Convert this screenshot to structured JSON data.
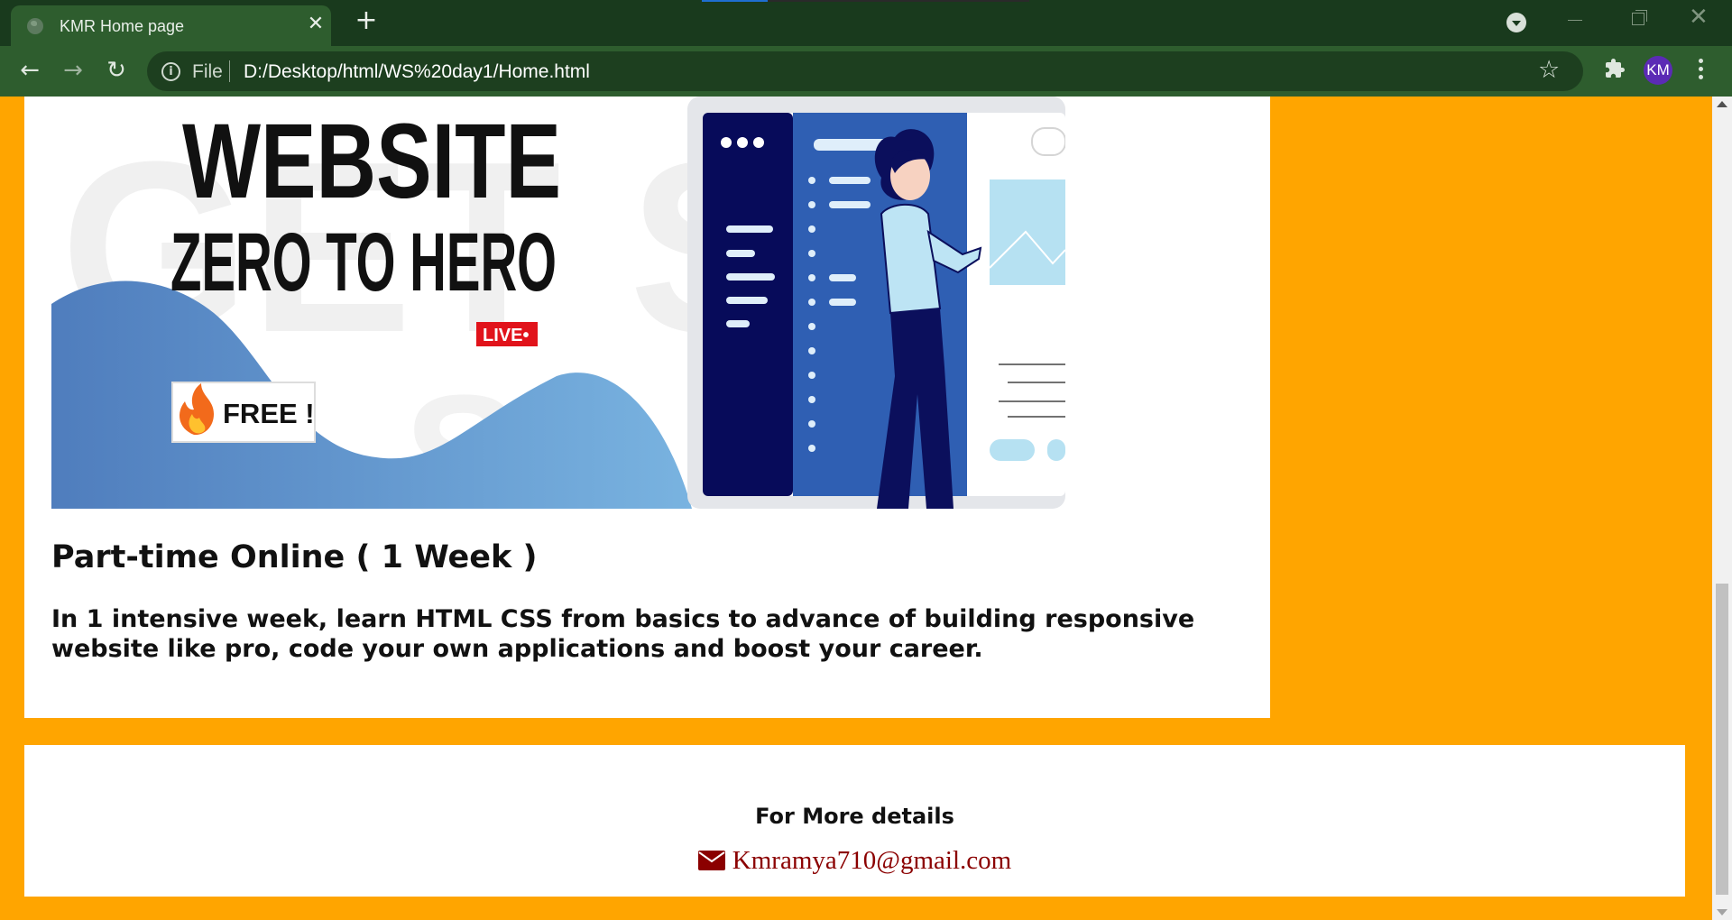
{
  "browser": {
    "tab_title": "KMR Home page",
    "close_glyph": "✕",
    "new_tab_glyph": "+",
    "back_glyph": "←",
    "forward_glyph": "→",
    "reload_glyph": "↻",
    "info_glyph": "i",
    "scheme": "File",
    "url": "D:/Desktop/html/WS%20day1/Home.html",
    "star_glyph": "☆",
    "window_close_glyph": "✕",
    "profile_initials": "KM"
  },
  "banner": {
    "heading_top": "WEBSITE",
    "heading_bottom": "ZERO TO HERO",
    "watermark": "GET STA",
    "watermark2": "ST",
    "live_badge": "LIVE•",
    "free_badge": "FREE !"
  },
  "course": {
    "title": "Part-time Online ( 1 Week )",
    "description": "In 1 intensive week, learn HTML CSS from basics to advance of building responsive website like pro, code your own applications and boost your career."
  },
  "footer": {
    "heading": "For More details",
    "email": "Kmramya710@gmail.com"
  },
  "colors": {
    "page_background": "#ffa500",
    "browser_frame": "#193a1d",
    "browser_toolbar": "#2e5d2e",
    "email_text": "#8b0000",
    "avatar": "#5b2bb5"
  },
  "icons": [
    "globe-icon",
    "close-icon",
    "plus-icon",
    "back-arrow-icon",
    "forward-arrow-icon",
    "reload-icon",
    "info-icon",
    "star-icon",
    "puzzle-icon",
    "kebab-menu-icon",
    "envelope-icon",
    "fire-icon"
  ]
}
